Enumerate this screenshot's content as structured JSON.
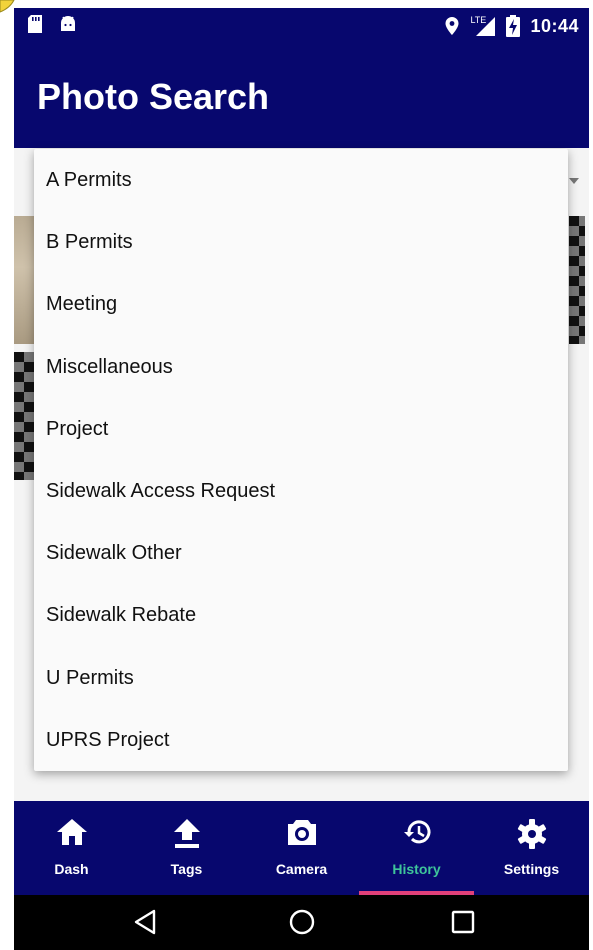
{
  "status_bar": {
    "network_label": "LTE",
    "time": "10:44"
  },
  "app_bar": {
    "title": "Photo Search"
  },
  "dropdown": {
    "items": [
      "A Permits",
      "B Permits",
      "Meeting",
      "Miscellaneous",
      "Project",
      "Sidewalk Access Request",
      "Sidewalk Other",
      "Sidewalk Rebate",
      "U Permits",
      "UPRS Project"
    ]
  },
  "bottom_nav": {
    "items": [
      {
        "label": "Dash",
        "icon": "home-icon"
      },
      {
        "label": "Tags",
        "icon": "upload-icon"
      },
      {
        "label": "Camera",
        "icon": "camera-icon"
      },
      {
        "label": "History",
        "icon": "history-icon"
      },
      {
        "label": "Settings",
        "icon": "gear-icon"
      }
    ],
    "active": "History",
    "active_color": "#3ec49a",
    "indicator_color": "#e0407a"
  },
  "colors": {
    "primary": "#07076e",
    "system_nav": "#000000"
  }
}
